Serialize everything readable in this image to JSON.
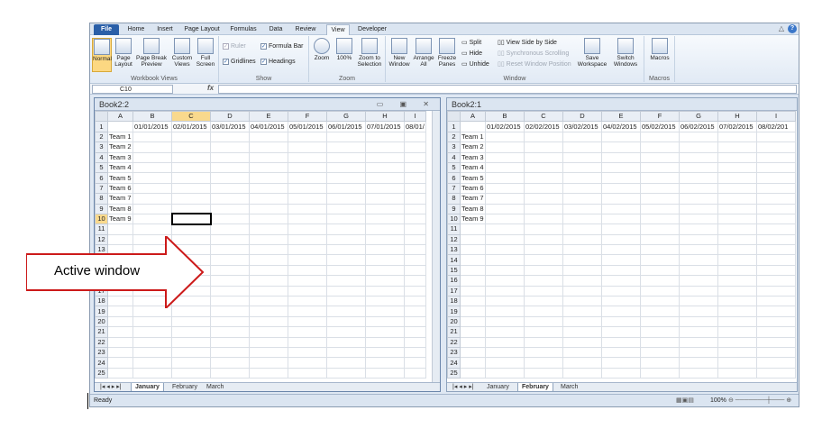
{
  "ribbon_tabs": [
    "File",
    "Home",
    "Insert",
    "Page Layout",
    "Formulas",
    "Data",
    "Review",
    "View",
    "Developer"
  ],
  "workbook_views": {
    "normal": "Normal",
    "page_layout": "Page Layout",
    "page_break": "Page Break Preview",
    "custom_views": "Custom Views",
    "full_screen": "Full Screen",
    "label": "Workbook Views"
  },
  "show": {
    "ruler": "Ruler",
    "formula_bar": "Formula Bar",
    "gridlines": "Gridlines",
    "headings": "Headings",
    "label": "Show"
  },
  "zoom": {
    "zoom": "Zoom",
    "hundred": "100%",
    "zoom_sel": "Zoom to Selection",
    "label": "Zoom"
  },
  "window": {
    "new_window": "New Window",
    "arrange_all": "Arrange All",
    "freeze": "Freeze Panes",
    "split": "Split",
    "hide": "Hide",
    "unhide": "Unhide",
    "side_by_side": "View Side by Side",
    "sync": "Synchronous Scrolling",
    "reset": "Reset Window Position",
    "save_ws": "Save Workspace",
    "switch": "Switch Windows",
    "label": "Window"
  },
  "macros": {
    "btn": "Macros",
    "label": "Macros"
  },
  "formula_bar": {
    "name_box": "C10",
    "fx": "fx"
  },
  "left_window": {
    "title": "Book2:2",
    "columns": [
      "A",
      "B",
      "C",
      "D",
      "E",
      "F",
      "G",
      "H",
      "I"
    ],
    "dates": [
      "01/01/2015",
      "02/01/2015",
      "03/01/2015",
      "04/01/2015",
      "05/01/2015",
      "06/01/2015",
      "07/01/2015",
      "08/01/"
    ],
    "sheets": [
      "January",
      "February",
      "March"
    ]
  },
  "right_window": {
    "title": "Book2:1",
    "columns": [
      "A",
      "B",
      "C",
      "D",
      "E",
      "F",
      "G",
      "H",
      "I"
    ],
    "dates": [
      "01/02/2015",
      "02/02/2015",
      "03/02/2015",
      "04/02/2015",
      "05/02/2015",
      "06/02/2015",
      "07/02/2015",
      "08/02/201"
    ],
    "sheets": [
      "January",
      "February",
      "March"
    ]
  },
  "teams": [
    "Team 1",
    "Team 2",
    "Team 3",
    "Team 4",
    "Team 5",
    "Team 6",
    "Team 7",
    "Team 8",
    "Team 9"
  ],
  "status": {
    "ready": "Ready",
    "zoom": "100%"
  },
  "annotation": "Active window"
}
